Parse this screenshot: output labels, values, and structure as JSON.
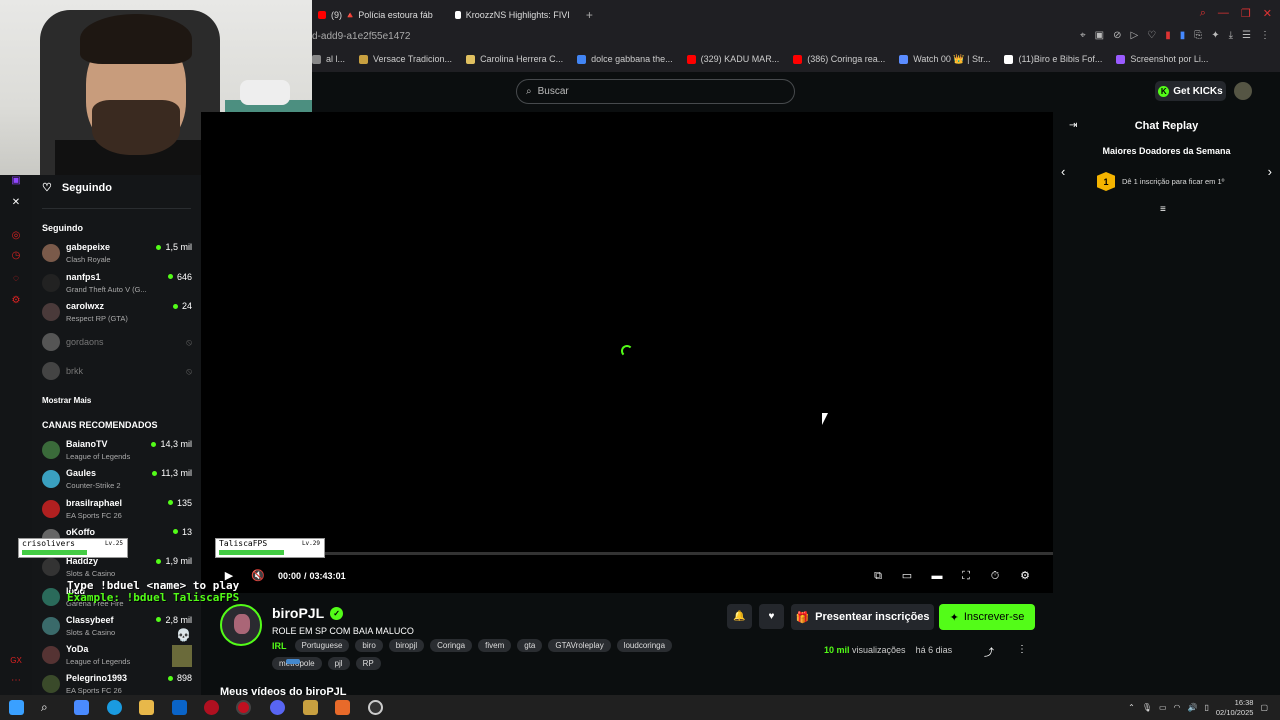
{
  "browser": {
    "tabs": [
      {
        "label": "(9) 🔺 Polícia estoura fáb",
        "icon": "youtube-icon",
        "color": "#ff0000"
      },
      {
        "label": "KroozzNS Highlights: FIVI",
        "icon": "tiktok-icon",
        "color": "#ffffff"
      }
    ],
    "new_tab": "+",
    "url": "d-add9-a1e2f55e1472",
    "bookmarks": [
      {
        "label": "al l...",
        "color": "#888888"
      },
      {
        "label": "Versace Tradicion...",
        "color": "#c8a040"
      },
      {
        "label": "Carolina Herrera C...",
        "color": "#e0c060"
      },
      {
        "label": "dolce gabbana the...",
        "color": "#4285f4"
      },
      {
        "label": "(329) KADU MAR...",
        "color": "#ff0000"
      },
      {
        "label": "(386) Coringa rea...",
        "color": "#ff0000"
      },
      {
        "label": "Watch 00 👑 | Str...",
        "color": "#5b8cff"
      },
      {
        "label": "(11)Biro e Bibis Fof...",
        "color": "#ffffff"
      },
      {
        "label": "Screenshot por Li...",
        "color": "#9a5bff"
      }
    ]
  },
  "header": {
    "search_placeholder": "Buscar",
    "get_kicks": "Get KICKs"
  },
  "sidebar": {
    "title": "Seguindo",
    "following_section": "Seguindo",
    "following": [
      {
        "name": "gabepeixe",
        "game": "Clash Royale",
        "viewers": "1,5 mil",
        "live": true,
        "color": "#7a5a4a"
      },
      {
        "name": "nanfps1",
        "game": "Grand Theft Auto V (G...",
        "viewers": "646",
        "live": true,
        "color": "#222222"
      },
      {
        "name": "carolwxz",
        "game": "Respect RP (GTA)",
        "viewers": "24",
        "live": true,
        "color": "#4a3a3a"
      },
      {
        "name": "gordaons",
        "game": "",
        "viewers": "",
        "live": false,
        "color": "#555555"
      },
      {
        "name": "brkk",
        "game": "",
        "viewers": "",
        "live": false,
        "color": "#444444"
      }
    ],
    "show_more": "Mostrar Mais",
    "recommended_section": "CANAIS RECOMENDADOS",
    "recommended": [
      {
        "name": "BaianoTV",
        "game": "League of Legends",
        "viewers": "14,3 mil",
        "color": "#3a6a3a"
      },
      {
        "name": "Gaules",
        "game": "Counter-Strike 2",
        "viewers": "11,3 mil",
        "color": "#3aa0c0"
      },
      {
        "name": "brasilraphael",
        "game": "EA Sports FC 26",
        "viewers": "135",
        "color": "#b02020"
      },
      {
        "name": "oKoffo",
        "game": "",
        "viewers": "13",
        "color": "#666666"
      },
      {
        "name": "Haddzy",
        "game": "Slots & Casino",
        "viewers": "1,9 mil",
        "color": "#333333"
      },
      {
        "name": "loud",
        "game": "Garena Free Fire",
        "viewers": "",
        "color": "#2a6a5a"
      },
      {
        "name": "Classybeef",
        "game": "Slots & Casino",
        "viewers": "2,8 mil",
        "color": "#3a6a6a"
      },
      {
        "name": "YoDa",
        "game": "League of Legends",
        "viewers": "5,",
        "color": "#553333"
      },
      {
        "name": "Pelegrino1993",
        "game": "EA Sports FC 26",
        "viewers": "898",
        "color": "#3a4a2a"
      }
    ]
  },
  "player": {
    "time_current": "00:00",
    "time_sep": "/",
    "time_total": "03:43:01",
    "progress": 0
  },
  "chat": {
    "title": "Chat Replay",
    "donors_title": "Maiores Doadores da Semana",
    "slot_rank": "1",
    "slot_text": "Dê 1 inscrição para ficar em 1º"
  },
  "stream": {
    "name": "biroPJL",
    "title": "ROLE EM SP COM BAIA MALUCO",
    "category": "IRL",
    "tags": [
      "Portuguese",
      "biro",
      "biropjl",
      "Coringa",
      "fivem",
      "gta",
      "GTAVroleplay",
      "loudcoringa",
      "metropole",
      "pjl",
      "RP"
    ],
    "gift_label": "Presentear inscrições",
    "subscribe_label": "Inscrever-se",
    "views_num": "10 mil",
    "views_label": "visualizações",
    "date": "há 6 dias",
    "vod_heading": "Meus vídeos do biroPJL"
  },
  "overlay": {
    "card1_name": "crisolivers",
    "card1_lv": "Lv.25",
    "card2_name": "TaliscaFPS",
    "card2_lv": "Lv.29",
    "line1": "Type !bduel <name> to play",
    "line2": "Example: !bduel TaliscaFPS"
  },
  "taskbar": {
    "time": "16:38",
    "date": "02/10/2025"
  },
  "colors": {
    "accent": "#53fc18",
    "background": "#0b0e0f",
    "panel": "#141618"
  }
}
